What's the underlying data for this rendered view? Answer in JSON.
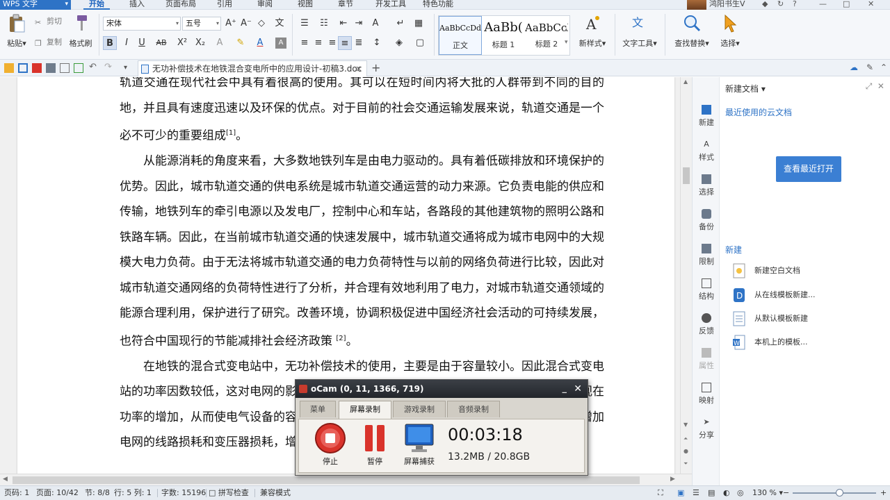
{
  "app": {
    "name": "WPS 文字",
    "menu_tabs": [
      "开始",
      "插入",
      "页面布局",
      "引用",
      "审阅",
      "视图",
      "章节",
      "开发工具",
      "特色功能"
    ],
    "active_tab": "开始",
    "user_name": "鸿阳书生V"
  },
  "ribbon": {
    "paste": "粘贴",
    "cut": "剪切",
    "copy": "复制",
    "format_painter": "格式刷",
    "font_name": "宋体",
    "font_size": "五号",
    "styles": [
      {
        "preview": "AaBbCcDd",
        "name": "正文"
      },
      {
        "preview": "AaBb(",
        "name": "标题 1"
      },
      {
        "preview": "AaBbCcI",
        "name": "标题 2"
      }
    ],
    "new_style": "新样式",
    "text_tools": "文字工具",
    "find_replace": "查找替换",
    "select": "选择"
  },
  "doc_tab": {
    "title": "无功补偿技术在地铁混合变电所中的应用设计-初稿3.doc",
    "close": "×",
    "new": "+"
  },
  "document": {
    "paragraphs": [
      {
        "indent": false,
        "text": "轨道交通在现代社会中具有着很高的使用。其可以在短时间内将大批的人群带到不同的目的地，并且具有速度迅速以及环保的优点。对于目前的社会交通运输发展来说，轨道交通是一个必不可少的重要组成",
        "sup": "[1]",
        "tail": "。"
      },
      {
        "indent": true,
        "text": "从能源消耗的角度来看，大多数地铁列车是由电力驱动的。具有着低碳排放和环境保护的优势。因此，城市轨道交通的供电系统是城市轨道交通运营的动力来源。它负责电能的供应和传输，地铁列车的牵引电源以及发电厂，控制中心和车站，各路段的其他建筑物的照明公路和铁路车辆。因此，在当前城市轨道交通的快速发展中，城市轨道交通将成为城市电网中的大规模大电力负荷。由于无法将城市轨道交通的电力负荷特性与以前的网络负荷进行比较，因此对城市轨道交通网络的负荷特性进行了分析，并合理有效地利用了电力，对城市轨道交通领域的能源合理利用，保护进行了研究。改善环境，协调积极促进中国经济社会活动的可持续发展，也符合中国现行的节能减排社会经济政策 ",
        "sup": "[2]",
        "tail": "。"
      },
      {
        "indent": true,
        "text": "在地铁的混合式变电站中，无功补偿技术的使用，主要是由于容量较小。因此混合式变电站的功率因数较低，这对电网的影响较大。功率因数较低，无功功率的增加将导致电流和视在功率的增加，从而使电气设备的容量增加，设备和线路的面积，较低的使用率，并会大大增加电网的线路损耗和变压器损耗，增加设备成本，增加线路损",
        "sup": "",
        "tail": ""
      }
    ]
  },
  "side_rail": [
    "新建",
    "样式",
    "选择",
    "备份",
    "限制",
    "结构",
    "反馈",
    "属性",
    "映射",
    "分享"
  ],
  "panel": {
    "title": "新建文档",
    "recent_link": "最近使用的云文档",
    "open_recent": "查看最近打开",
    "new_section": "新建",
    "items": [
      "新建空白文档",
      "从在线模板新建...",
      "从默认模板新建",
      "本机上的模板..."
    ]
  },
  "status": {
    "page": "页码: 1",
    "page_of": "页面: 10/42",
    "section": "节: 8/8",
    "row_col": "行: 5  列: 1",
    "word_count": "字数: 15196",
    "spell_check": "拼写检查",
    "compat": "兼容模式",
    "zoom": "130 %"
  },
  "ocam": {
    "title": "oCam (0, 11, 1366, 719)",
    "tabs": [
      "菜单",
      "屏幕录制",
      "游戏录制",
      "音频录制"
    ],
    "active_tab": "屏幕录制",
    "buttons": [
      "停止",
      "暂停",
      "屏幕捕获"
    ],
    "elapsed": "00:03:18",
    "size": "13.2MB / 20.8GB"
  },
  "colors": {
    "accent": "#2e73c6",
    "record_red": "#d9332b"
  }
}
